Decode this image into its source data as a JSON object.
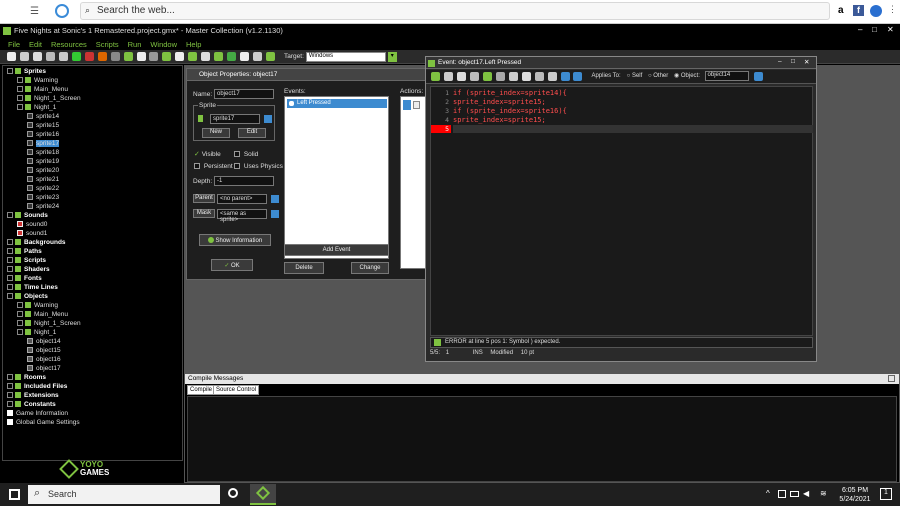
{
  "browser": {
    "search_placeholder": "Search the web..."
  },
  "window": {
    "title": "Five Nights at Sonic's 1 Remastered.project.gmx* - Master Collection (v1.2.1130)"
  },
  "menu": [
    "File",
    "Edit",
    "Resources",
    "Scripts",
    "Run",
    "Window",
    "Help"
  ],
  "toolbar": {
    "target_label": "Target:",
    "target_value": "Windows"
  },
  "tree": {
    "rows": [
      {
        "label": "Sprites",
        "type": "folder",
        "bold": true,
        "indent": 0
      },
      {
        "label": "Warning",
        "type": "folder",
        "indent": 1
      },
      {
        "label": "Main_Menu",
        "type": "folder",
        "indent": 1
      },
      {
        "label": "Night_1_Screen",
        "type": "folder",
        "indent": 1
      },
      {
        "label": "Night_1",
        "type": "folder",
        "indent": 1
      },
      {
        "label": "sprite14",
        "type": "sprite",
        "indent": 2
      },
      {
        "label": "sprite15",
        "type": "sprite",
        "indent": 2
      },
      {
        "label": "sprite16",
        "type": "sprite",
        "indent": 2
      },
      {
        "label": "sprite17",
        "type": "sprite",
        "indent": 2,
        "selected": true
      },
      {
        "label": "sprite18",
        "type": "sprite",
        "indent": 2
      },
      {
        "label": "sprite19",
        "type": "sprite",
        "indent": 2
      },
      {
        "label": "sprite20",
        "type": "sprite",
        "indent": 2
      },
      {
        "label": "sprite21",
        "type": "sprite",
        "indent": 2
      },
      {
        "label": "sprite22",
        "type": "sprite",
        "indent": 2
      },
      {
        "label": "sprite23",
        "type": "sprite",
        "indent": 2
      },
      {
        "label": "sprite24",
        "type": "sprite",
        "indent": 2
      },
      {
        "label": "Sounds",
        "type": "folder",
        "bold": true,
        "indent": 0
      },
      {
        "label": "sound0",
        "type": "sound",
        "indent": 1
      },
      {
        "label": "sound1",
        "type": "sound",
        "indent": 1
      },
      {
        "label": "Backgrounds",
        "type": "folder",
        "bold": true,
        "indent": 0
      },
      {
        "label": "Paths",
        "type": "folder",
        "bold": true,
        "indent": 0
      },
      {
        "label": "Scripts",
        "type": "folder",
        "bold": true,
        "indent": 0
      },
      {
        "label": "Shaders",
        "type": "folder",
        "bold": true,
        "indent": 0
      },
      {
        "label": "Fonts",
        "type": "folder",
        "bold": true,
        "indent": 0
      },
      {
        "label": "Time Lines",
        "type": "folder",
        "bold": true,
        "indent": 0
      },
      {
        "label": "Objects",
        "type": "folder",
        "bold": true,
        "indent": 0
      },
      {
        "label": "Warning",
        "type": "folder",
        "indent": 1
      },
      {
        "label": "Main_Menu",
        "type": "folder",
        "indent": 1
      },
      {
        "label": "Night_1_Screen",
        "type": "folder",
        "indent": 1
      },
      {
        "label": "Night_1",
        "type": "folder",
        "indent": 1
      },
      {
        "label": "object14",
        "type": "object",
        "indent": 2
      },
      {
        "label": "object15",
        "type": "object",
        "indent": 2
      },
      {
        "label": "object16",
        "type": "object",
        "indent": 2
      },
      {
        "label": "object17",
        "type": "object",
        "indent": 2
      },
      {
        "label": "Rooms",
        "type": "folder",
        "bold": true,
        "indent": 0
      },
      {
        "label": "Included Files",
        "type": "folder",
        "bold": true,
        "indent": 0
      },
      {
        "label": "Extensions",
        "type": "folder",
        "bold": true,
        "indent": 0
      },
      {
        "label": "Constants",
        "type": "folder",
        "bold": true,
        "indent": 0
      },
      {
        "label": "Game Information",
        "type": "doc",
        "indent": 0
      },
      {
        "label": "Global Game Settings",
        "type": "doc",
        "indent": 0
      }
    ]
  },
  "logo": {
    "line1": "YOYO",
    "line2": "GAMES"
  },
  "object_properties": {
    "title": "Object Properties: object17",
    "name_label": "Name:",
    "name_value": "object17",
    "sprite_group_label": "Sprite",
    "sprite_value": "sprite17",
    "new_label": "New",
    "edit_label": "Edit",
    "visible_label": "Visible",
    "solid_label": "Solid",
    "persistent_label": "Persistent",
    "uses_physics_label": "Uses Physics",
    "depth_label": "Depth:",
    "depth_value": "-1",
    "parent_label": "Parent",
    "parent_value": "<no parent>",
    "mask_label": "Mask",
    "mask_value": "<same as sprite>",
    "show_info_label": "Show Information",
    "ok_label": "OK",
    "events_label": "Events:",
    "event_item": "Left Pressed",
    "add_event_label": "Add Event",
    "delete_label": "Delete",
    "change_label": "Change",
    "actions_label": "Actions:"
  },
  "code_editor": {
    "title": "Event: object17.Left Pressed",
    "applies_to_label": "Applies To:",
    "self_label": "Self",
    "other_label": "Other",
    "object_label": "Object:",
    "object_value": "object14",
    "lines": [
      "if (sprite_index=sprite14){",
      "sprite_index=sprite15;",
      "if (sprite_index=sprite16){",
      "sprite_index=sprite15;",
      ""
    ],
    "error_message": "ERROR at line 5 pos 1: Symbol ) expected.",
    "status_pos": "5/5:",
    "status_col": "1",
    "status_ins": "INS",
    "status_modified": "Modified",
    "status_font": "10 pt"
  },
  "compile": {
    "title": "Compile Messages",
    "tab_compile": "Compile",
    "tab_source_control": "Source Control"
  },
  "taskbar": {
    "search_label": "Search",
    "time": "6:05 PM",
    "date": "5/24/2021",
    "notif_count": "1"
  },
  "colors": {
    "accent": "#7fc241",
    "selection": "#3d8bd0",
    "error": "#ff0000"
  }
}
